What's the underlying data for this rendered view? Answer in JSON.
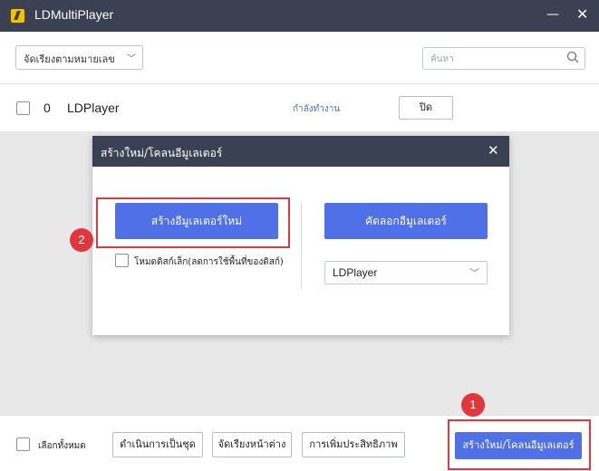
{
  "window": {
    "title": "LDMultiPlayer",
    "minimize_glyph": "—",
    "close_glyph": "✕"
  },
  "toolbar": {
    "sort_label": "จัดเรียงตามหมายเลข",
    "sort_chevron": "﹀",
    "search_placeholder": "ค้นหา"
  },
  "instances": [
    {
      "index": "0",
      "name": "LDPlayer",
      "status": "กำลังทำงาน",
      "action_label": "ปิด"
    }
  ],
  "dialog": {
    "title": "สร้างใหม่/โคลนอีมูเลเตอร์",
    "close_glyph": "✕",
    "new_button": "สร้างอีมูเลเตอร์ใหม่",
    "copy_button": "คัดลอกอีมูเลเตอร์",
    "small_mode_label": "โหมดดิสก์เล็ก(ลดการใช้พื้นที่ของดิสก์)",
    "source_select_value": "LDPlayer",
    "source_chevron": "﹀",
    "step_badge": "2"
  },
  "footer": {
    "select_all_label": "เลือกทั้งหมด",
    "batch_button": "ดำเนินการเป็นชุด",
    "arrange_button": "จัดเรียงหน้าต่าง",
    "optimize_button": "การเพิ่มประสิทธิภาพ",
    "create_button": "สร้างใหม่/โคลนอีมูเลเตอร์",
    "step_badge": "1"
  },
  "colors": {
    "titlebar": "#3a4152",
    "accent": "#5070e8",
    "highlight": "#e0383e",
    "status_text": "#4d6ed8"
  }
}
